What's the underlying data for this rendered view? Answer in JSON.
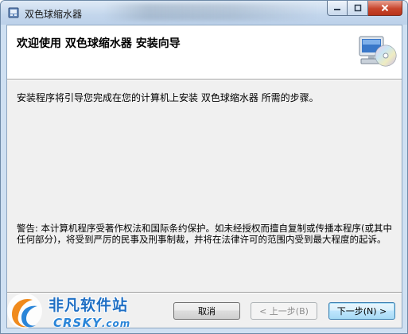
{
  "window": {
    "title": "双色球缩水器",
    "buttons": {
      "minimize_icon": "minimize-icon",
      "maximize_icon": "maximize-icon",
      "close_icon": "close-icon"
    }
  },
  "header": {
    "title": "欢迎使用 双色球缩水器 安装向导"
  },
  "body": {
    "intro": "安装程序将引导您完成在您的计算机上安装 双色球缩水器 所需的步骤。",
    "warning": "警告: 本计算机程序受著作权法和国际条约保护。如未经授权而擅自复制或传播本程序(或其中任何部分)，将受到严厉的民事及刑事制裁，并将在法律许可的范围内受到最大程度的起诉。"
  },
  "footer": {
    "cancel_label": "取消",
    "back_label": "< 上一步(B)",
    "next_label": "下一步(N) >"
  },
  "watermark": {
    "cn": "非凡软件站",
    "en": "CRSKY",
    "en_suffix": ".com"
  },
  "colors": {
    "title_bar": "#c3d6ec",
    "close_button": "#c8452c",
    "watermark_blue": "#1f6fc4"
  }
}
